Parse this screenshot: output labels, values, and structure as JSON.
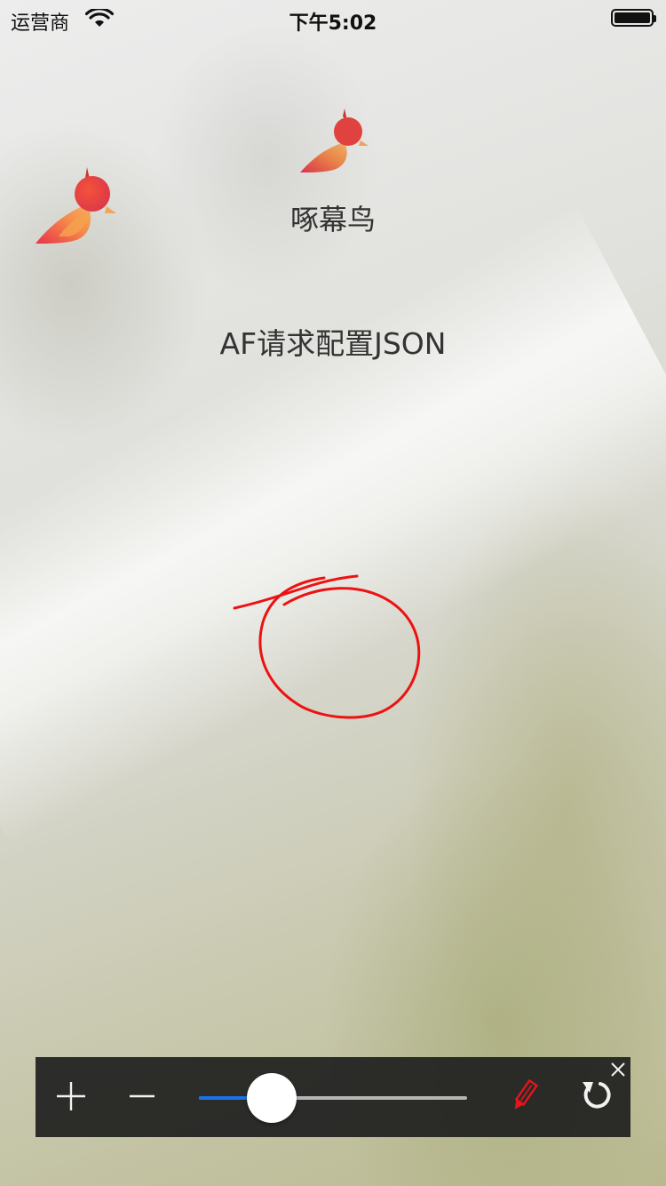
{
  "status_bar": {
    "carrier": "运营商",
    "time": "下午5:02"
  },
  "app": {
    "name": "啄幕鸟",
    "title": "AF请求配置JSON"
  },
  "toolbar": {
    "zoom_in_icon": "plus-icon",
    "zoom_out_icon": "minus-icon",
    "slider_value": 0.27,
    "pencil_icon": "pencil-icon",
    "pencil_color": "#e8141c",
    "undo_icon": "undo-icon",
    "close_icon": "close-icon",
    "accent": "#1a73e8"
  }
}
